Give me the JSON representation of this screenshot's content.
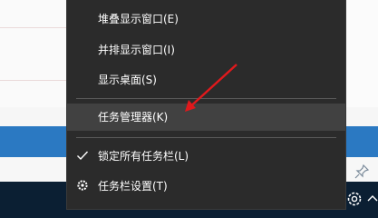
{
  "context_menu": {
    "items": [
      {
        "label": "堆叠显示窗口(E)"
      },
      {
        "label": "并排显示窗口(I)"
      },
      {
        "label": "显示桌面(S)"
      },
      {
        "label": "任务管理器(K)"
      },
      {
        "label": "锁定所有任务栏(L)"
      },
      {
        "label": "任务栏设置(T)"
      }
    ],
    "hovered_item": "任务管理器(K)",
    "checked_item": "锁定所有任务栏(L)"
  },
  "annotation": {
    "arrow_color": "#e0191c"
  },
  "icons": {
    "check": "checkmark-icon",
    "settings": "gear-icon",
    "tray_settings": "gear-icon",
    "tray_overflow": "chevron-up-icon",
    "pin": "pin-icon"
  },
  "colors": {
    "menu_bg": "#2b2b2b",
    "menu_hover": "#414141",
    "taskbar": "#0b1f33",
    "accent_bar": "#2b79c2"
  }
}
